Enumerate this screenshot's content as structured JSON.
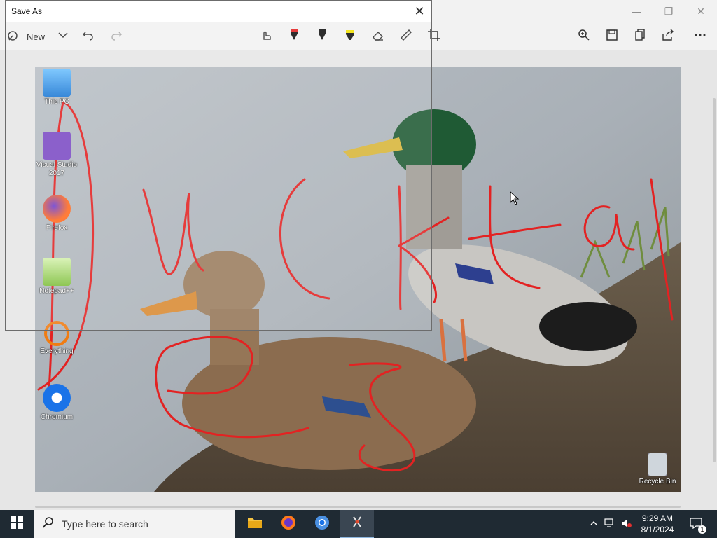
{
  "app": {
    "new_label": "New",
    "tools": [
      "touch-writing-icon",
      "ballpoint-pen-icon",
      "pencil-icon",
      "highlighter-icon",
      "eraser-icon",
      "ruler-icon",
      "crop-icon"
    ],
    "right_tools": [
      "zoom-icon",
      "save-icon",
      "copy-icon",
      "share-icon",
      "more-icon"
    ]
  },
  "dialog": {
    "title": "Save As"
  },
  "desktop": {
    "icons": [
      {
        "label": "This PC"
      },
      {
        "label": "Visual Studio 2017"
      },
      {
        "label": "Firefox"
      },
      {
        "label": "Notepad++"
      },
      {
        "label": "Everything"
      },
      {
        "label": "Chromium"
      },
      {
        "label": "Recycle Bin"
      }
    ]
  },
  "taskbar": {
    "search_placeholder": "Type here to search",
    "time": "9:29 AM",
    "date": "8/1/2024",
    "notification_count": "1"
  },
  "colors": {
    "ink": "#e32222",
    "accent": "#1f6fd1",
    "taskbar": "#1f2a33"
  }
}
